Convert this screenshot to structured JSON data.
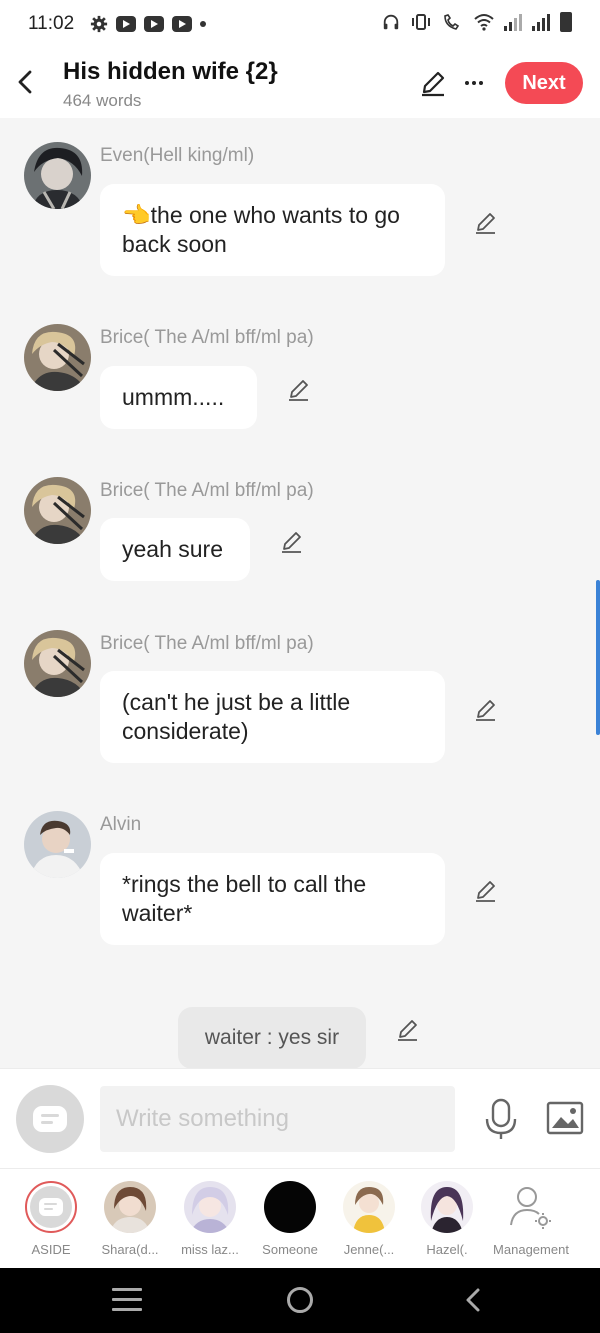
{
  "status_bar": {
    "time": "11:02"
  },
  "header": {
    "title": "His hidden wife {2}",
    "word_count": "464 words",
    "next_label": "Next"
  },
  "messages": [
    {
      "name": "Even(Hell king/ml)",
      "text": "👈the one who wants to go back soon",
      "avatar": "avatar-dark-haired"
    },
    {
      "name": "Brice( The A/ml bff/ml pa)",
      "text": "ummm.....",
      "avatar": "avatar-blond"
    },
    {
      "name": "Brice( The A/ml bff/ml pa)",
      "text": "yeah sure",
      "avatar": "avatar-blond"
    },
    {
      "name": "Brice( The A/ml bff/ml pa)",
      "text": "(can't he just be a little considerate)",
      "avatar": "avatar-blond"
    },
    {
      "name": "Alvin",
      "text": "*rings the bell to call the waiter*",
      "avatar": "avatar-photo-man"
    }
  ],
  "aside_message": {
    "text": "waiter : yes sir"
  },
  "compose": {
    "placeholder": "Write something"
  },
  "tabs": [
    {
      "label": "ASIDE"
    },
    {
      "label": "Shara(d..."
    },
    {
      "label": "miss laz..."
    },
    {
      "label": "Someone"
    },
    {
      "label": "Jenne(..."
    },
    {
      "label": "Hazel(."
    },
    {
      "label": "Management"
    }
  ],
  "colors": {
    "accent": "#f44a55",
    "scroll_indicator": "#3b82d6"
  }
}
